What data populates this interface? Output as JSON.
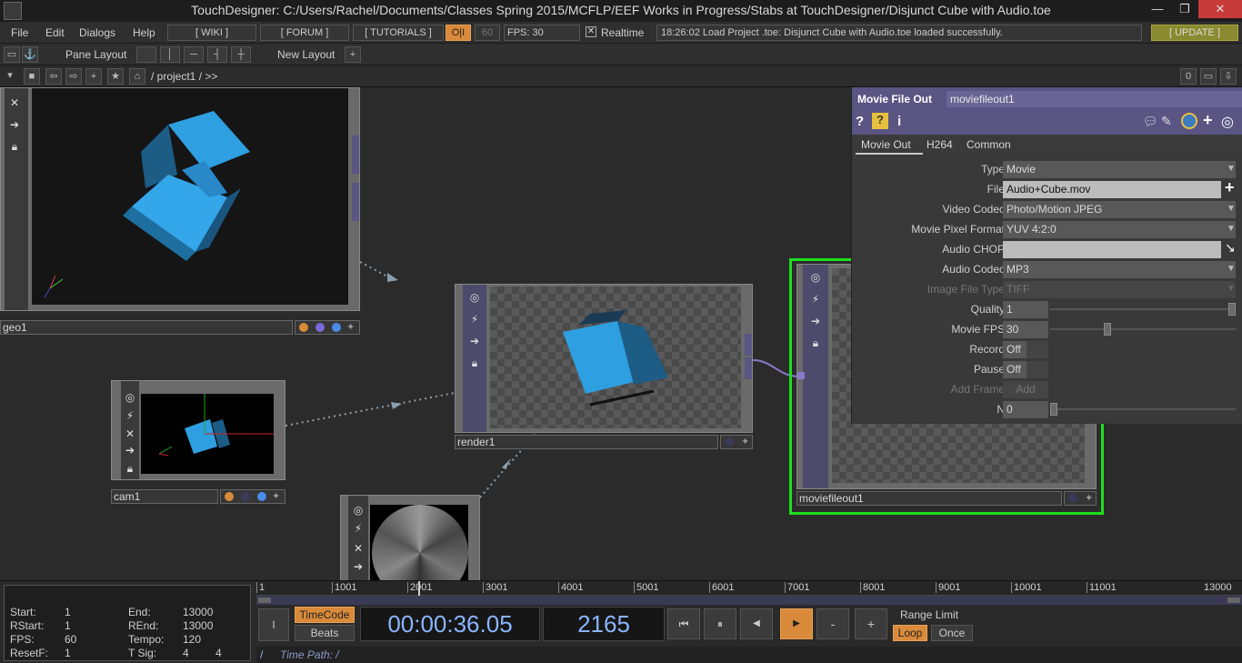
{
  "window": {
    "title": "TouchDesigner: C:/Users/Rachel/Documents/Classes Spring 2015/MCFLP/EEF Works in Progress/Stabs at TouchDesigner/Disjunct Cube with Audio.toe",
    "min_glyph": "—",
    "max_glyph": "❐",
    "close_glyph": "✕"
  },
  "menu": {
    "file": "File",
    "edit": "Edit",
    "dialogs": "Dialogs",
    "help": "Help",
    "wiki": "[ WIKI ]",
    "forum": "[ FORUM ]",
    "tutorials": "[ TUTORIALS ]",
    "oi": "O|I",
    "fps_target": "60",
    "fps": "FPS:  30",
    "realtime": "Realtime",
    "status": "18:26:02 Load Project .toe: Disjunct Cube with Audio.toe loaded successfully.",
    "update": "[ UPDATE ]"
  },
  "toolbar": {
    "pane_layout": "Pane Layout",
    "new_layout": "New Layout",
    "plus": "+",
    "path": "/ project1 / >>",
    "zero": "0"
  },
  "nodes": {
    "geo1": "geo1",
    "cam1": "cam1",
    "render1": "render1",
    "moviefileout1": "moviefileout1"
  },
  "panel": {
    "op_type": "Movie File Out",
    "op_name": "moviefileout1",
    "tabs": [
      "Movie Out",
      "H264",
      "Common"
    ],
    "params": [
      {
        "label": "Type",
        "value": "Movie",
        "kind": "menu"
      },
      {
        "label": "File",
        "value": "Audio+Cube.mov",
        "kind": "file"
      },
      {
        "label": "Video Codec",
        "value": "Photo/Motion JPEG",
        "kind": "menu"
      },
      {
        "label": "Movie Pixel Format",
        "value": "YUV 4:2:0",
        "kind": "menu"
      },
      {
        "label": "Audio CHOP",
        "value": "",
        "kind": "chop"
      },
      {
        "label": "Audio Codec",
        "value": "MP3",
        "kind": "menu"
      },
      {
        "label": "Image File Type",
        "value": "TIFF",
        "kind": "menu-disabled"
      },
      {
        "label": "Quality",
        "value": "1",
        "kind": "slider",
        "level": 1.0
      },
      {
        "label": "Movie FPS",
        "value": "30",
        "kind": "slider",
        "level": 0.3
      },
      {
        "label": "Record",
        "value": "Off",
        "kind": "toggle"
      },
      {
        "label": "Pause",
        "value": "Off",
        "kind": "toggle"
      },
      {
        "label": "Add Frame",
        "value": "Add",
        "kind": "button-disabled"
      },
      {
        "label": "N",
        "value": "0",
        "kind": "slider",
        "level": 0.0
      }
    ]
  },
  "timeline": {
    "start_label": "Start:",
    "start": "1",
    "end_label": "End:",
    "end": "13000",
    "rstart_label": "RStart:",
    "rstart": "1",
    "rend_label": "REnd:",
    "rend": "13000",
    "fps_label": "FPS:",
    "fps": "60",
    "tempo_label": "Tempo:",
    "tempo": "120",
    "resetf_label": "ResetF:",
    "resetf": "1",
    "tsig_label": "T Sig:",
    "tsig_a": "4",
    "tsig_b": "4",
    "ticks": [
      "1",
      "1001",
      "2001",
      "3001",
      "4001",
      "5001",
      "6001",
      "7001",
      "8001",
      "9001",
      "10001",
      "11001",
      "13000"
    ],
    "timecode_btn": "TimeCode",
    "beats_btn": "Beats",
    "timecode": "00:00:36.05",
    "frame": "2165",
    "range_limit": "Range Limit",
    "loop": "Loop",
    "once": "Once",
    "time_path_label": "Time Path: /",
    "slash": "/",
    "cursor": "I",
    "minus": "-",
    "plus": "+"
  },
  "colors": {
    "accent_purple": "#5a5583",
    "orange": "#d98a3a",
    "selected_green": "#1de01d",
    "cube_blue": "#2e9fe0",
    "timecode_blue": "#8ab4ff"
  }
}
